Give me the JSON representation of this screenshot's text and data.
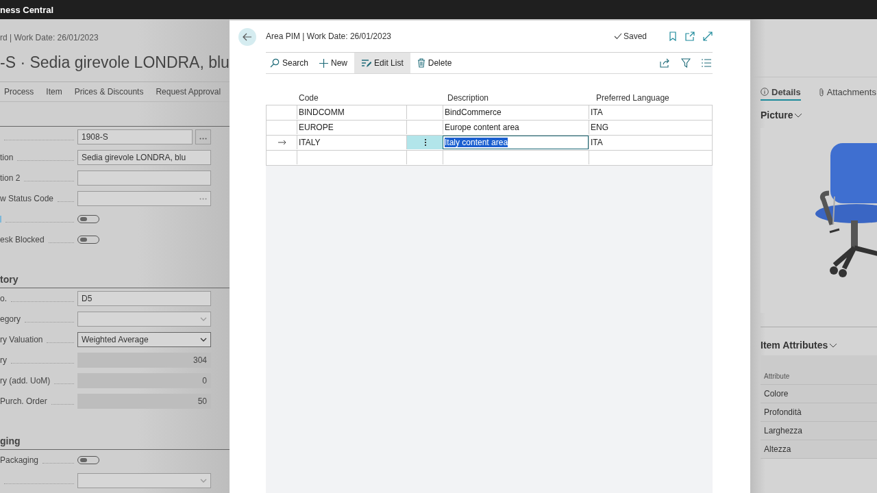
{
  "app_bar": {
    "title": "ness Central"
  },
  "background_card": {
    "breadcrumb": "rd | Work Date: 26/01/2023",
    "title": "-S · Sedia girevole LONDRA, blu",
    "actions": [
      "Process",
      "Item",
      "Prices & Discounts",
      "Request Approval"
    ],
    "sections": [
      {
        "fields": [
          {
            "kind": "lookup",
            "value": "1908-S"
          },
          {
            "label": "tion",
            "kind": "text",
            "value": "Sedia girevole LONDRA, blu"
          },
          {
            "label": "tion 2",
            "kind": "text"
          },
          {
            "label": "w Status Code",
            "kind": "lookup_inline"
          },
          {
            "kind": "toggle",
            "on": false
          },
          {
            "label": "esk Blocked",
            "kind": "toggle",
            "on": false
          }
        ]
      },
      {
        "heading": "tory",
        "fields": [
          {
            "label": "o.",
            "kind": "text",
            "value": "D5"
          },
          {
            "label": "egory",
            "kind": "dropdown"
          },
          {
            "label": "ry Valuation",
            "kind": "dropdown",
            "value": "Weighted Average"
          },
          {
            "label": "ry",
            "kind": "number",
            "value": "304"
          },
          {
            "label": "ry (add. UoM)",
            "kind": "number",
            "value": "0"
          },
          {
            "label": "Purch. Order",
            "kind": "number",
            "value": "50"
          }
        ]
      },
      {
        "heading": "ging",
        "fields": [
          {
            "label": "Packaging",
            "kind": "toggle",
            "on": false
          },
          {
            "kind": "dropdown"
          }
        ]
      }
    ]
  },
  "dialog": {
    "breadcrumb": "Area PIM | Work Date: 26/01/2023",
    "status": "Saved",
    "toolbar": [
      {
        "kind": "search",
        "label": "Search",
        "selected": false
      },
      {
        "kind": "new",
        "label": "New",
        "selected": false
      },
      {
        "kind": "edit",
        "label": "Edit List",
        "selected": true
      },
      {
        "kind": "delete",
        "label": "Delete",
        "selected": false
      }
    ],
    "table": {
      "columns": {
        "code": "Code",
        "description": "Description",
        "language": "Preferred Language"
      },
      "rows": [
        {
          "code": "BINDCOMM",
          "description": "BindCommerce",
          "language": "ITA",
          "selected": false
        },
        {
          "code": "EUROPE",
          "description": "Europe content area",
          "language": "ENG",
          "selected": false
        },
        {
          "code": "ITALY",
          "description": "Italy content area",
          "language": "ITA",
          "selected": true
        }
      ]
    }
  },
  "factbox": {
    "tabs": [
      {
        "kind": "info",
        "label": "Details",
        "selected": true
      },
      {
        "kind": "attach",
        "label": "Attachments",
        "selected": false
      }
    ],
    "picture_heading": "Picture",
    "attributes_heading": "Item Attributes",
    "attributes_column": "Attribute",
    "attributes": [
      "Colore",
      "Profondità",
      "Larghezza",
      "Altezza"
    ]
  }
}
